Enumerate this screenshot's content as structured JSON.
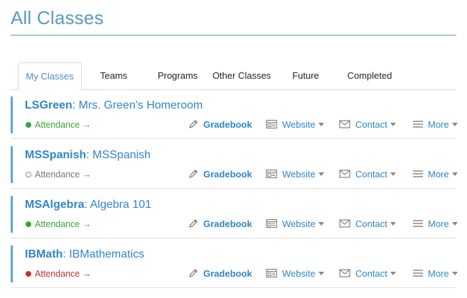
{
  "page": {
    "title": "All Classes"
  },
  "tabs": [
    {
      "label": "My Classes",
      "active": true
    },
    {
      "label": "Teams"
    },
    {
      "label": "Programs"
    },
    {
      "label": "Other Classes"
    },
    {
      "label": "Future"
    },
    {
      "label": "Completed"
    }
  ],
  "actions": {
    "gradebook": "Gradebook",
    "website": "Website",
    "contact": "Contact",
    "more": "More"
  },
  "classes": [
    {
      "code": "LSGreen",
      "separator": ": ",
      "name": "Mrs. Green's Homeroom",
      "attendance_label": "Attendance",
      "attendance_arrow": "→",
      "attendance_status": "complete"
    },
    {
      "code": "MSSpanish",
      "separator": ": ",
      "name": "MSSpanish",
      "attendance_label": "Attendance",
      "attendance_arrow": "→",
      "attendance_status": "not-applicable"
    },
    {
      "code": "MSAlgebra",
      "separator": ": ",
      "name": "Algebra 101",
      "attendance_label": "Attendance",
      "attendance_arrow": "→",
      "attendance_status": "complete"
    },
    {
      "code": "IBMath",
      "separator": ": ",
      "name": "IBMathematics",
      "attendance_label": "Attendance",
      "attendance_arrow": "→",
      "attendance_status": "incomplete"
    }
  ],
  "colors": {
    "title": "#5b9ab8",
    "link": "#2f86c8",
    "accent_bar": "#5aa6d3",
    "attendance_complete": "#3aa43a",
    "attendance_incomplete": "#c23030",
    "attendance_none": "#777777"
  }
}
